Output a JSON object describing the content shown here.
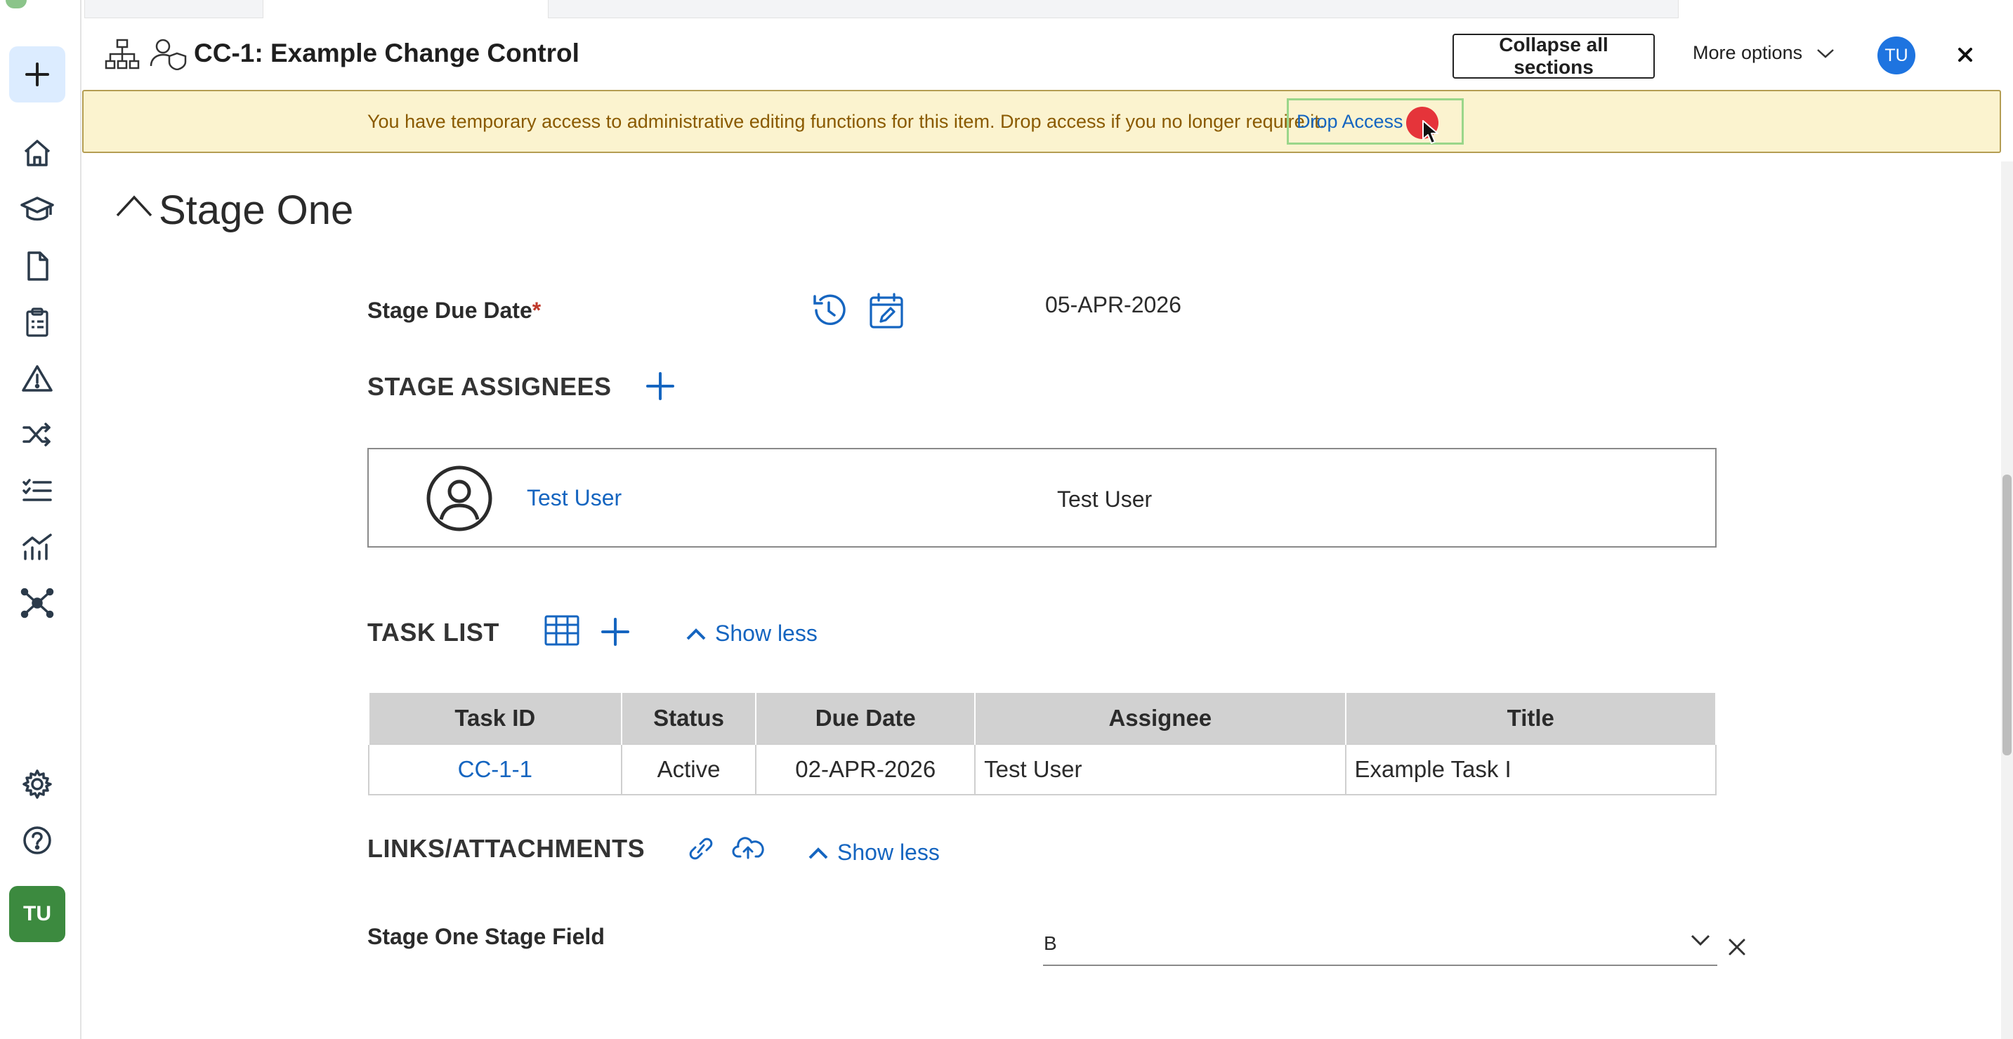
{
  "header": {
    "title": "CC-1: Example Change Control",
    "collapse_label": "Collapse all sections",
    "more_options_label": "More options",
    "avatar_initials": "TU"
  },
  "banner": {
    "message": "You have temporary access to administrative editing functions for this item. Drop access if you no longer require it.",
    "action_label": "Drop Access"
  },
  "sidebar": {
    "avatar_initials": "TU",
    "icons": [
      "plus-icon",
      "home-icon",
      "graduation-cap-icon",
      "document-icon",
      "clipboard-icon",
      "warning-icon",
      "shuffle-icon",
      "checklist-icon",
      "chart-icon",
      "network-icon",
      "gear-icon",
      "help-icon"
    ]
  },
  "stage": {
    "title": "Stage One",
    "due_date_label": "Stage Due Date",
    "due_date_required": "*",
    "due_date_value": "05-APR-2026",
    "assignees_heading": "STAGE ASSIGNEES",
    "assignees": [
      {
        "link": "Test User",
        "name": "Test User"
      }
    ],
    "task_list": {
      "heading": "TASK LIST",
      "show_less": "Show less",
      "columns": [
        "Task ID",
        "Status",
        "Due Date",
        "Assignee",
        "Title"
      ],
      "rows": [
        [
          "CC-1-1",
          "Active",
          "02-APR-2026",
          "Test User",
          "Example Task I"
        ]
      ]
    },
    "links": {
      "heading": "LINKS/ATTACHMENTS",
      "show_less": "Show less"
    },
    "stage_field": {
      "label": "Stage One Stage Field",
      "value": "B"
    }
  },
  "colors": {
    "accent": "#1565c0",
    "banner_bg": "#fbf3cf",
    "banner_text": "#8a5a00",
    "sidebar_avatar": "#3c8a3f",
    "header_avatar": "#1e74e0"
  }
}
